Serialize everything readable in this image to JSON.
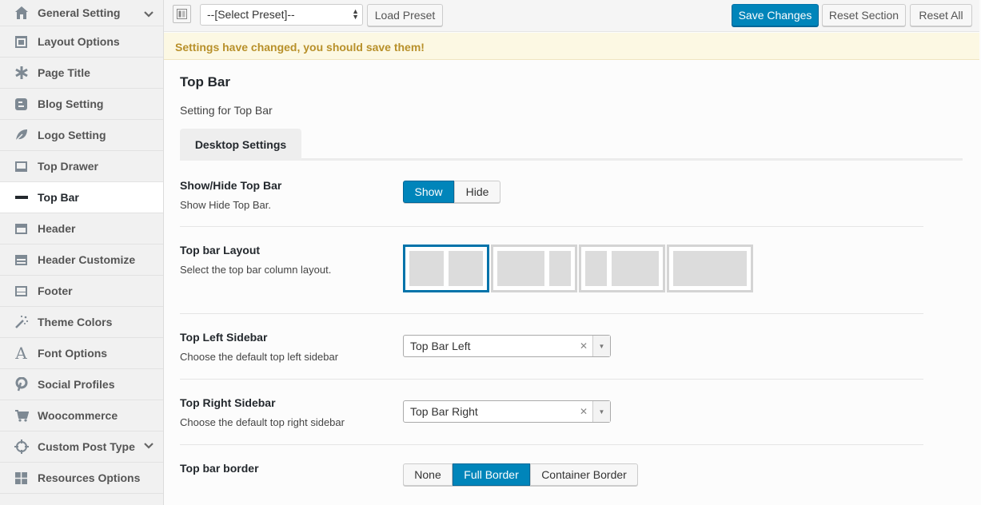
{
  "sidebar": {
    "items": [
      {
        "label": "General Setting",
        "icon": "home-icon"
      },
      {
        "label": "Layout Options",
        "icon": "layout-icon"
      },
      {
        "label": "Page Title",
        "icon": "asterisk-icon"
      },
      {
        "label": "Blog Setting",
        "icon": "blogger-icon"
      },
      {
        "label": "Logo Setting",
        "icon": "leaf-icon"
      },
      {
        "label": "Top Drawer",
        "icon": "drawer-icon"
      },
      {
        "label": "Top Bar",
        "icon": "minus-icon"
      },
      {
        "label": "Header",
        "icon": "header-icon"
      },
      {
        "label": "Header Customize",
        "icon": "header-customize-icon"
      },
      {
        "label": "Footer",
        "icon": "footer-icon"
      },
      {
        "label": "Theme Colors",
        "icon": "magic-wand-icon"
      },
      {
        "label": "Font Options",
        "icon": "font-icon"
      },
      {
        "label": "Social Profiles",
        "icon": "pinterest-icon"
      },
      {
        "label": "Woocommerce",
        "icon": "cart-icon"
      },
      {
        "label": "Custom Post Type",
        "icon": "crosshair-icon"
      },
      {
        "label": "Resources Options",
        "icon": "grid-icon"
      }
    ]
  },
  "toolbar": {
    "preset_value": "--[Select Preset]--",
    "load_preset": "Load Preset",
    "save_changes": "Save Changes",
    "reset_section": "Reset Section",
    "reset_all": "Reset All"
  },
  "notice": "Settings have changed, you should save them!",
  "section": {
    "title": "Top Bar",
    "desc": "Setting for Top Bar",
    "tab": "Desktop Settings"
  },
  "rows": {
    "show_hide": {
      "title": "Show/Hide Top Bar",
      "desc": "Show Hide Top Bar.",
      "options": [
        "Show",
        "Hide"
      ],
      "selected": "Show"
    },
    "layout": {
      "title": "Top bar Layout",
      "desc": "Select the top bar column layout."
    },
    "left_sidebar": {
      "title": "Top Left Sidebar",
      "desc": "Choose the default top left sidebar",
      "value": "Top Bar Left"
    },
    "right_sidebar": {
      "title": "Top Right Sidebar",
      "desc": "Choose the default top right sidebar",
      "value": "Top Bar Right"
    },
    "border": {
      "title": "Top bar border",
      "options": [
        "None",
        "Full Border",
        "Container Border"
      ],
      "selected": "Full Border"
    }
  },
  "colors": {
    "primary": "#0085ba",
    "notice_text": "#b8902a",
    "notice_bg": "#fcf8e3"
  }
}
